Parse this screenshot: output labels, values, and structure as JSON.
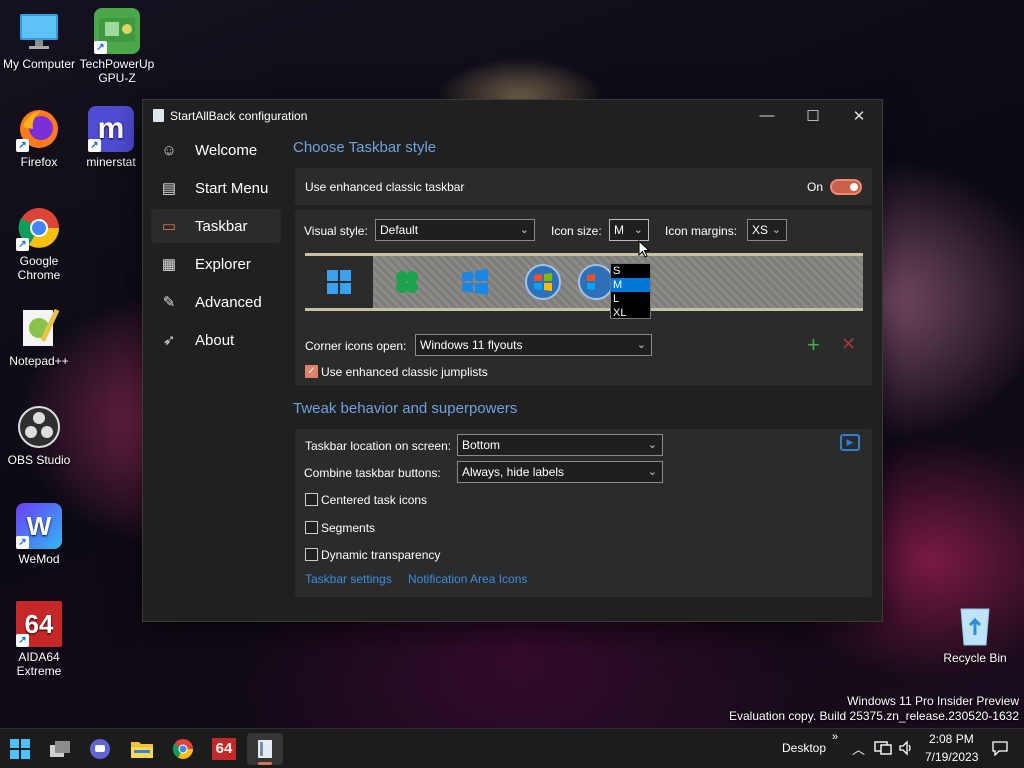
{
  "desktop": {
    "icons": [
      {
        "label": "My Computer",
        "icon": "computer-icon"
      },
      {
        "label": "TechPowerUp GPU-Z",
        "icon": "gpu-z-icon"
      },
      {
        "label": "Firefox",
        "icon": "firefox-icon"
      },
      {
        "label": "minerstat",
        "icon": "minerstat-icon"
      },
      {
        "label": "Google Chrome",
        "icon": "chrome-icon"
      },
      {
        "label": "Notepad++",
        "icon": "notepadpp-icon"
      },
      {
        "label": "OBS Studio",
        "icon": "obs-icon"
      },
      {
        "label": "WeMod",
        "icon": "wemod-icon"
      },
      {
        "label": "AIDA64 Extreme",
        "icon": "aida64-icon"
      },
      {
        "label": "Recycle Bin",
        "icon": "recycle-bin-icon"
      }
    ],
    "watermark_line1": "Windows 11 Pro Insider Preview",
    "watermark_line2": "Evaluation copy. Build 25375.zn_release.230520-1632"
  },
  "window": {
    "title": "StartAllBack configuration",
    "controls": {
      "minimize": "—",
      "maximize": "☐",
      "close": "✕"
    }
  },
  "sidebar": {
    "items": [
      {
        "label": "Welcome",
        "icon": "smiley-icon",
        "glyph": "☺"
      },
      {
        "label": "Start Menu",
        "icon": "start-menu-icon",
        "glyph": "▤"
      },
      {
        "label": "Taskbar",
        "icon": "taskbar-icon",
        "glyph": "▭"
      },
      {
        "label": "Explorer",
        "icon": "folder-icon",
        "glyph": "▦"
      },
      {
        "label": "Advanced",
        "icon": "wrench-icon",
        "glyph": "✎"
      },
      {
        "label": "About",
        "icon": "about-icon",
        "glyph": "➶"
      }
    ],
    "active": "Taskbar"
  },
  "taskbar_style": {
    "heading": "Choose Taskbar style",
    "enhanced_label": "Use enhanced classic taskbar",
    "enhanced_state": "On",
    "visual_style_label": "Visual style:",
    "visual_style_value": "Default",
    "icon_size_label": "Icon size:",
    "icon_size_value": "M",
    "icon_size_options": [
      "S",
      "M",
      "L",
      "XL"
    ],
    "icon_margins_label": "Icon margins:",
    "icon_margins_value": "XS",
    "corner_icons_label": "Corner icons open:",
    "corner_icons_value": "Windows 11 flyouts",
    "jumplists_label": "Use enhanced classic jumplists",
    "jumplists_checked": true
  },
  "tweak": {
    "heading": "Tweak behavior and superpowers",
    "location_label": "Taskbar location on screen:",
    "location_value": "Bottom",
    "combine_label": "Combine taskbar buttons:",
    "combine_value": "Always, hide labels",
    "centered_label": "Centered task icons",
    "segments_label": "Segments",
    "dynamic_label": "Dynamic transparency",
    "link_taskbar_settings": "Taskbar settings",
    "link_notification_icons": "Notification Area Icons"
  },
  "taskbar": {
    "desktop_label": "Desktop",
    "time": "2:08 PM",
    "date": "7/19/2023",
    "chevron": "»",
    "aida_label": "64"
  }
}
